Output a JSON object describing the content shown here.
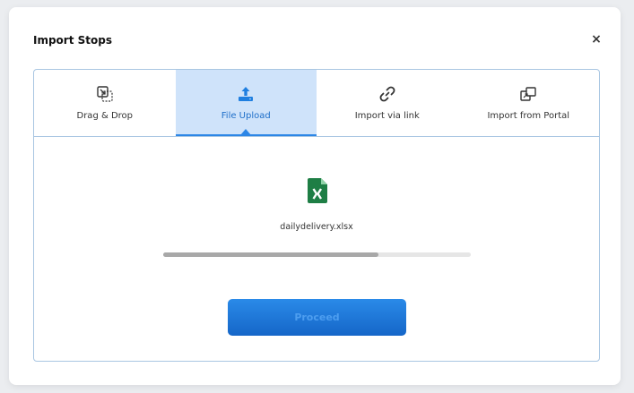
{
  "modal": {
    "title": "Import Stops",
    "close_label": "×"
  },
  "tabs": [
    {
      "label": "Drag & Drop",
      "icon": "drag-drop-icon",
      "active": false
    },
    {
      "label": "File Upload",
      "icon": "upload-icon",
      "active": true
    },
    {
      "label": "Import via link",
      "icon": "link-icon",
      "active": false
    },
    {
      "label": "Import from Portal",
      "icon": "portal-icon",
      "active": false
    }
  ],
  "upload": {
    "file_name": "dailydelivery.xlsx",
    "file_icon": "excel-file-icon",
    "progress_percent": 70
  },
  "actions": {
    "proceed_label": "Proceed"
  },
  "colors": {
    "accent": "#2c86e6",
    "active_tab_bg": "#cfe3fa",
    "panel_border": "#a9c6e2",
    "excel_green": "#1e7e45"
  }
}
